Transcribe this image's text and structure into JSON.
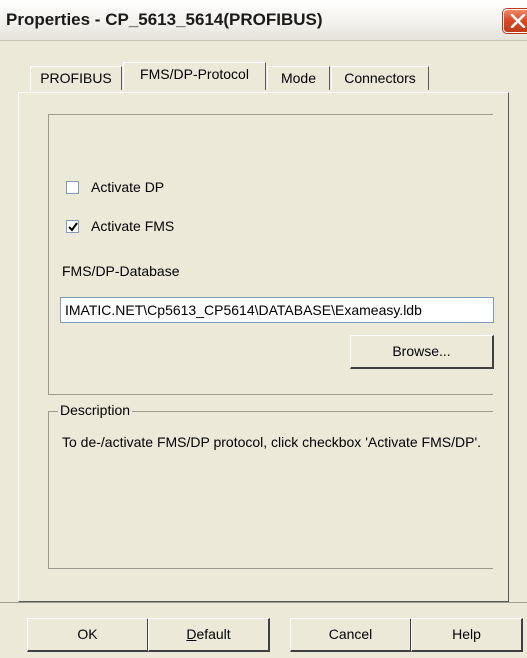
{
  "window": {
    "title": "Properties - CP_5613_5614(PROFIBUS)"
  },
  "tabs": [
    {
      "label": "PROFIBUS",
      "active": false
    },
    {
      "label": "FMS/DP-Protocol",
      "active": true
    },
    {
      "label": "Mode",
      "active": false
    },
    {
      "label": "Connectors",
      "active": false
    }
  ],
  "protocol": {
    "activate_dp": {
      "label": "Activate DP",
      "checked": false
    },
    "activate_fms": {
      "label": "Activate FMS",
      "checked": true
    },
    "database_label": "FMS/DP-Database",
    "database_value": "IMATIC.NET\\Cp5613_CP5614\\DATABASE\\Exameasy.ldb",
    "browse_label": "Browse..."
  },
  "description": {
    "legend": "Description",
    "text": "To de-/activate FMS/DP protocol, click checkbox 'Activate FMS/DP'."
  },
  "footer": {
    "ok_label": "OK",
    "default_label_prefix": "",
    "default_label_mnemonic": "D",
    "default_label_rest": "efault",
    "cancel_label": "Cancel",
    "help_label": "Help"
  },
  "colors": {
    "dialog_bg": "#ece9d8",
    "close_button": "#dd4a25",
    "input_border": "#7f9db9"
  }
}
